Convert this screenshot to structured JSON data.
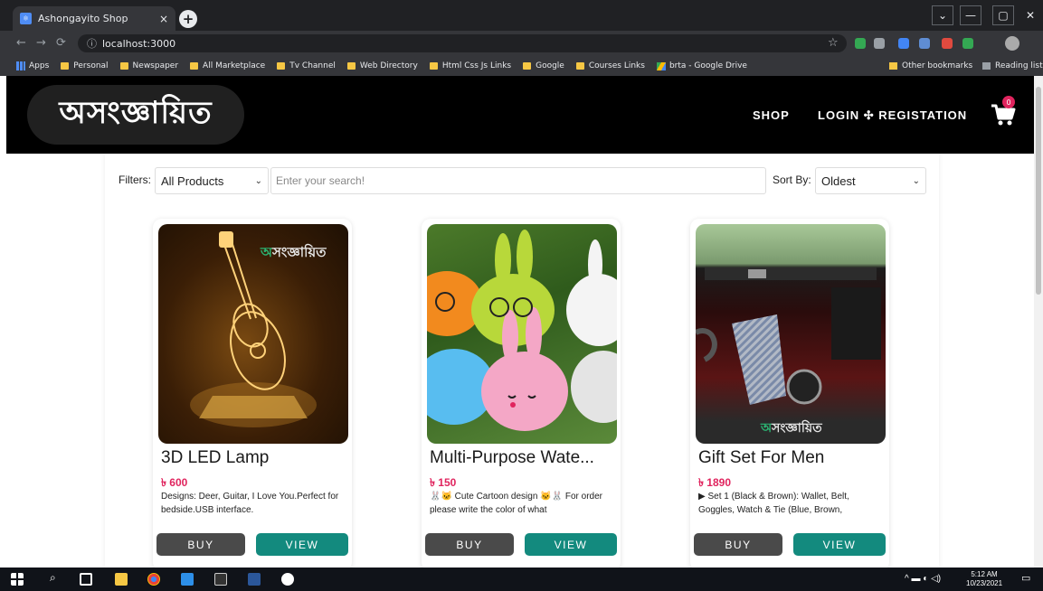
{
  "browser": {
    "tab_title": "Ashongayito Shop",
    "tab_close": "×",
    "new_tab": "+",
    "url": "localhost:3000",
    "bookmarks": [
      "Apps",
      "Personal",
      "Newspaper",
      "All Marketplace",
      "Tv Channel",
      "Web Directory",
      "Html Css Js Links",
      "Google",
      "Courses Links",
      "brta - Google Drive"
    ],
    "other_bookmarks": "Other bookmarks",
    "reading_list": "Reading list"
  },
  "header": {
    "logo_text": "অসংজ্ঞায়িত",
    "nav": {
      "shop": "SHOP",
      "login_registration": "LOGIN ✣ REGISTATION"
    },
    "cart_count": "0"
  },
  "filters": {
    "label": "Filters:",
    "category_value": "All Products",
    "search_placeholder": "Enter your search!",
    "sort_label": "Sort By:",
    "sort_value": "Oldest"
  },
  "products": [
    {
      "title": "3D LED Lamp",
      "price": "৳ 600",
      "description": "Designs: Deer, Guitar, I Love You.Perfect for bedside.USB interface.",
      "buy": "BUY",
      "view": "VIEW"
    },
    {
      "title": "Multi-Purpose Wate...",
      "price": "৳ 150",
      "description": "🐰🐱 Cute Cartoon design 🐱🐰 For order please write the color of what",
      "buy": "BUY",
      "view": "VIEW"
    },
    {
      "title": "Gift Set For Men",
      "price": "৳ 1890",
      "description": "▶ Set 1 (Black & Brown): Wallet, Belt, Goggles, Watch & Tie (Blue, Brown,",
      "buy": "BUY",
      "view": "VIEW"
    }
  ],
  "taskbar": {
    "time": "5:12 AM",
    "date": "10/23/2021"
  },
  "colors": {
    "accent_teal": "#138a7e",
    "price_red": "#e0245e",
    "header_black": "#000000",
    "logo_green": "#2bb673"
  }
}
